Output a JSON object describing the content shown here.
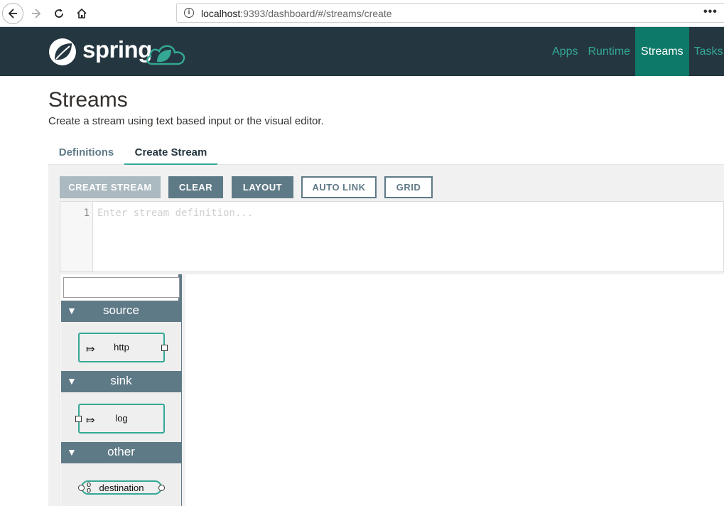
{
  "browser": {
    "url_host": "localhost",
    "url_rest": ":9393/dashboard/#/streams/create",
    "more_icon": "ellipsis-icon"
  },
  "header": {
    "logo_text": "spring",
    "nav": [
      {
        "label": "Apps",
        "active": false
      },
      {
        "label": "Runtime",
        "active": false
      },
      {
        "label": "Streams",
        "active": true
      },
      {
        "label": "Tasks",
        "active": false
      }
    ]
  },
  "page": {
    "title": "Streams",
    "subtitle": "Create a stream using text based input or the visual editor."
  },
  "tabs": {
    "definitions": "Definitions",
    "create_stream": "Create Stream"
  },
  "toolbar": {
    "create": "CREATE STREAM",
    "clear": "CLEAR",
    "layout": "LAYOUT",
    "auto_link": "AUTO LINK",
    "grid": "GRID"
  },
  "editor": {
    "line_number": "1",
    "placeholder": "Enter stream definition..."
  },
  "palette": {
    "filter_value": "",
    "groups": [
      {
        "name": "source",
        "items": [
          {
            "label": "http"
          }
        ]
      },
      {
        "name": "sink",
        "items": [
          {
            "label": "log"
          }
        ]
      },
      {
        "name": "other",
        "items": [
          {
            "label": "destination"
          }
        ]
      }
    ]
  },
  "colors": {
    "header_bg": "#243640",
    "accent": "#34a894",
    "active_nav": "#0d7969",
    "slate": "#5f7a87"
  }
}
